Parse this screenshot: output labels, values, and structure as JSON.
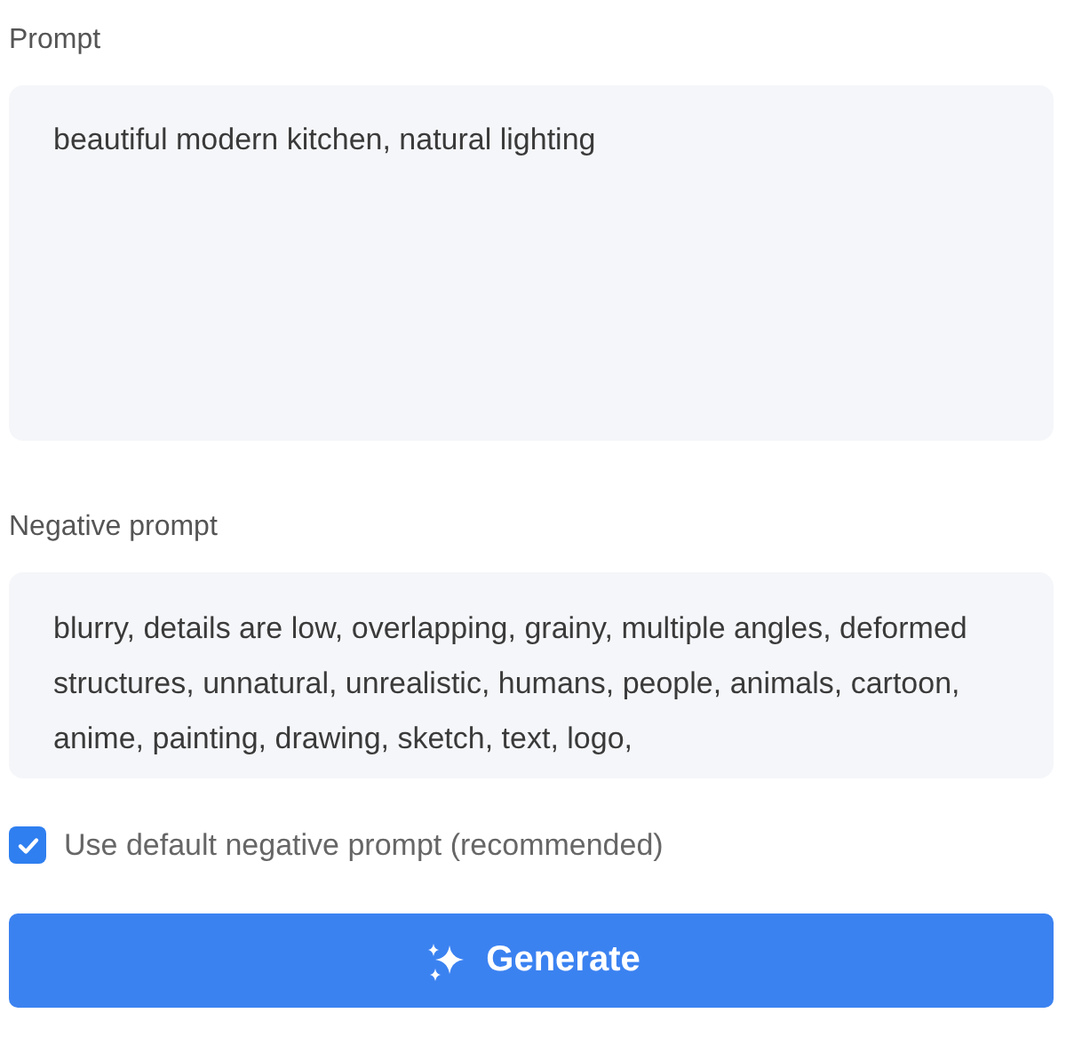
{
  "prompt": {
    "label": "Prompt",
    "value": "beautiful modern kitchen, natural lighting"
  },
  "negative_prompt": {
    "label": "Negative prompt",
    "value": "blurry, details are low, overlapping, grainy, multiple angles, deformed structures, unnatural, unrealistic, humans, people, animals, cartoon, anime, painting, drawing, sketch, text, logo,"
  },
  "use_default_negative": {
    "label": "Use default negative prompt (recommended)",
    "checked": true
  },
  "generate_button": {
    "label": "Generate"
  }
}
